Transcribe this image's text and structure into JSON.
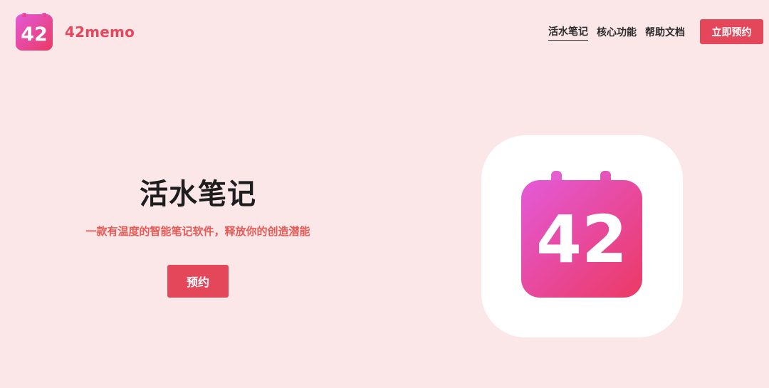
{
  "brand": {
    "logo_number": "42",
    "name": "42memo"
  },
  "nav": {
    "items": [
      {
        "label": "活水笔记",
        "active": true
      },
      {
        "label": "核心功能",
        "active": false
      },
      {
        "label": "帮助文档",
        "active": false
      }
    ],
    "cta_label": "立即预约"
  },
  "hero": {
    "title": "活水笔记",
    "subtitle": "一款有温度的智能笔记软件，释放你的创造潜能",
    "cta_label": "预约",
    "app_icon_number": "42"
  },
  "colors": {
    "page_background": "#fbe6e8",
    "accent": "#e5475a",
    "brand_text": "#e8465c",
    "subtitle_text": "#e55a55",
    "icon_gradient_start": "#e35ad8",
    "icon_gradient_end": "#ec3964"
  },
  "icons": {
    "brand_logo": "calendar-42-icon",
    "hero_icon": "calendar-42-icon"
  }
}
